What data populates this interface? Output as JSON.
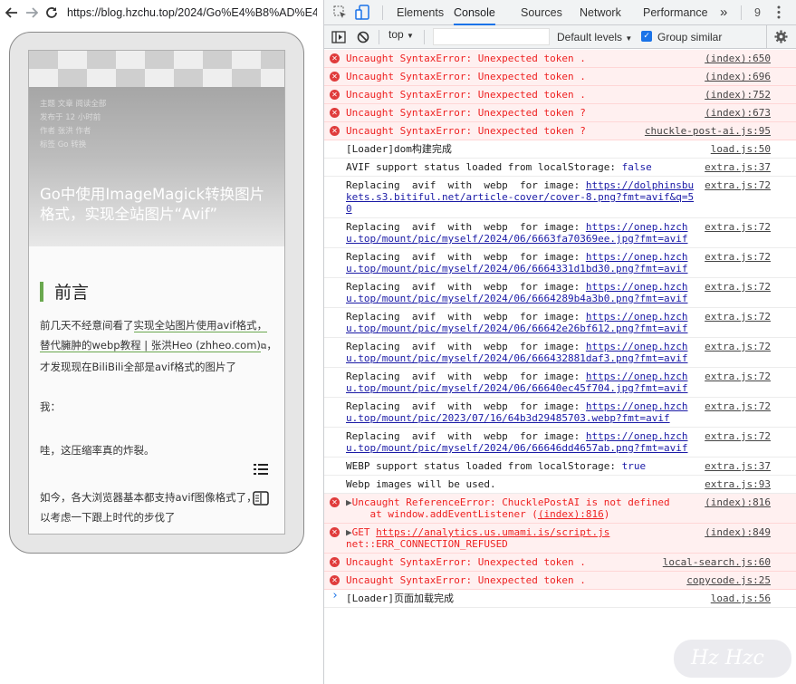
{
  "browser": {
    "url": "https://blog.hzchu.top/2024/Go%E4%B8%AD%E4%"
  },
  "article": {
    "meta": [
      "主题  文章  阅读全部",
      "发布于  12 小时前",
      "作者  张洪  作者",
      "标签  Go  转换"
    ],
    "hero_title": "Go中使用ImageMagick转换图片格式，实现全站图片“Avif”",
    "section_title": "前言",
    "para1_pre": "前几天不经意间看了",
    "para1_link": "实现全站图片使用avif格式，替代臃肿的webp教程 | 张洪Heo (zhheo.com)",
    "para1_post": "，才发现现在BiliBili全部是avif格式的图片了",
    "para2": "我：",
    "para3": "哇，这压缩率真的炸裂。",
    "para4": "如今，各大浏览器基本都支持avif图像格式了，可以考虑一下跟上时代的步伐了"
  },
  "devtools": {
    "tabs": [
      "Elements",
      "Console",
      "Sources",
      "Network",
      "Performance"
    ],
    "active_tab": "Console",
    "more": "»",
    "issue_count": "9",
    "context": "top",
    "filter_placeholder": "",
    "log_levels": "Default levels",
    "group_similar": "Group similar",
    "prompt": "›"
  },
  "console": [
    {
      "level": "error",
      "text": "Uncaught SyntaxError: Unexpected token .",
      "source": "(index):650"
    },
    {
      "level": "error",
      "text": "Uncaught SyntaxError: Unexpected token .",
      "source": "(index):696"
    },
    {
      "level": "error",
      "text": "Uncaught SyntaxError: Unexpected token .",
      "source": "(index):752"
    },
    {
      "level": "error",
      "text": "Uncaught SyntaxError: Unexpected token ?",
      "source": "(index):673"
    },
    {
      "level": "error",
      "text": "Uncaught SyntaxError: Unexpected token ?",
      "source": "chuckle-post-ai.js:95"
    },
    {
      "level": "log",
      "text": "[Loader]dom构建完成",
      "source": "load.js:50"
    },
    {
      "level": "log",
      "text": "AVIF support status loaded from localStorage: ",
      "value": "false",
      "source": "extra.js:37"
    },
    {
      "level": "log",
      "text": "Replacing  avif  with  webp  for image: ",
      "link": "https://dolphinsbukets.s3.bitiful.net/article-cover/cover-8.png?fmt=avif&q=50",
      "source": "extra.js:72"
    },
    {
      "level": "log",
      "text": "Replacing  avif  with  webp  for image: ",
      "link": "https://onep.hzchu.top/mount/pic/myself/2024/06/6663fa70369ee.jpg?fmt=avif",
      "source": "extra.js:72"
    },
    {
      "level": "log",
      "text": "Replacing  avif  with  webp  for image: ",
      "link": "https://onep.hzchu.top/mount/pic/myself/2024/06/6664331d1bd30.png?fmt=avif",
      "source": "extra.js:72"
    },
    {
      "level": "log",
      "text": "Replacing  avif  with  webp  for image: ",
      "link": "https://onep.hzchu.top/mount/pic/myself/2024/06/6664289b4a3b0.png?fmt=avif",
      "source": "extra.js:72"
    },
    {
      "level": "log",
      "text": "Replacing  avif  with  webp  for image: ",
      "link": "https://onep.hzchu.top/mount/pic/myself/2024/06/66642e26bf612.png?fmt=avif",
      "source": "extra.js:72"
    },
    {
      "level": "log",
      "text": "Replacing  avif  with  webp  for image: ",
      "link": "https://onep.hzchu.top/mount/pic/myself/2024/06/666432881daf3.png?fmt=avif",
      "source": "extra.js:72"
    },
    {
      "level": "log",
      "text": "Replacing  avif  with  webp  for image: ",
      "link": "https://onep.hzchu.top/mount/pic/myself/2024/06/66640ec45f704.jpg?fmt=avif",
      "source": "extra.js:72"
    },
    {
      "level": "log",
      "text": "Replacing  avif  with  webp  for image: ",
      "link": "https://onep.hzchu.top/mount/pic/2023/07/16/64b3d29485703.webp?fmt=avif",
      "source": "extra.js:72"
    },
    {
      "level": "log",
      "text": "Replacing  avif  with  webp  for image: ",
      "link": "https://onep.hzchu.top/mount/pic/myself/2024/06/66646dd4657ab.png?fmt=avif",
      "source": "extra.js:72"
    },
    {
      "level": "log",
      "text": "WEBP support status loaded from localStorage: ",
      "value": "true",
      "source": "extra.js:37"
    },
    {
      "level": "log",
      "text": "Webp images will be used.",
      "source": "extra.js:93"
    },
    {
      "level": "error",
      "expandable": true,
      "text": "Uncaught ReferenceError: ChucklePostAI is not defined\n    at window.addEventListener (",
      "link": "(index):816",
      "tail": ")",
      "source": "(index):816"
    },
    {
      "level": "error",
      "expandable": true,
      "text": "GET ",
      "link": "https://analytics.us.umami.is/script.js",
      "tail": "\nnet::ERR_CONNECTION_REFUSED",
      "source": "(index):849"
    },
    {
      "level": "error",
      "text": "Uncaught SyntaxError: Unexpected token .",
      "source": "local-search.js:60"
    },
    {
      "level": "error",
      "text": "Uncaught SyntaxError: Unexpected token .",
      "source": "copycode.js:25"
    },
    {
      "level": "log",
      "text": "[Loader]页面加载完成",
      "source": "load.js:56"
    }
  ],
  "watermark": "Hz Hzc",
  "colors": {
    "accent": "#1a73e8",
    "error": "#e22222",
    "section_bar": "#6aa84f"
  }
}
